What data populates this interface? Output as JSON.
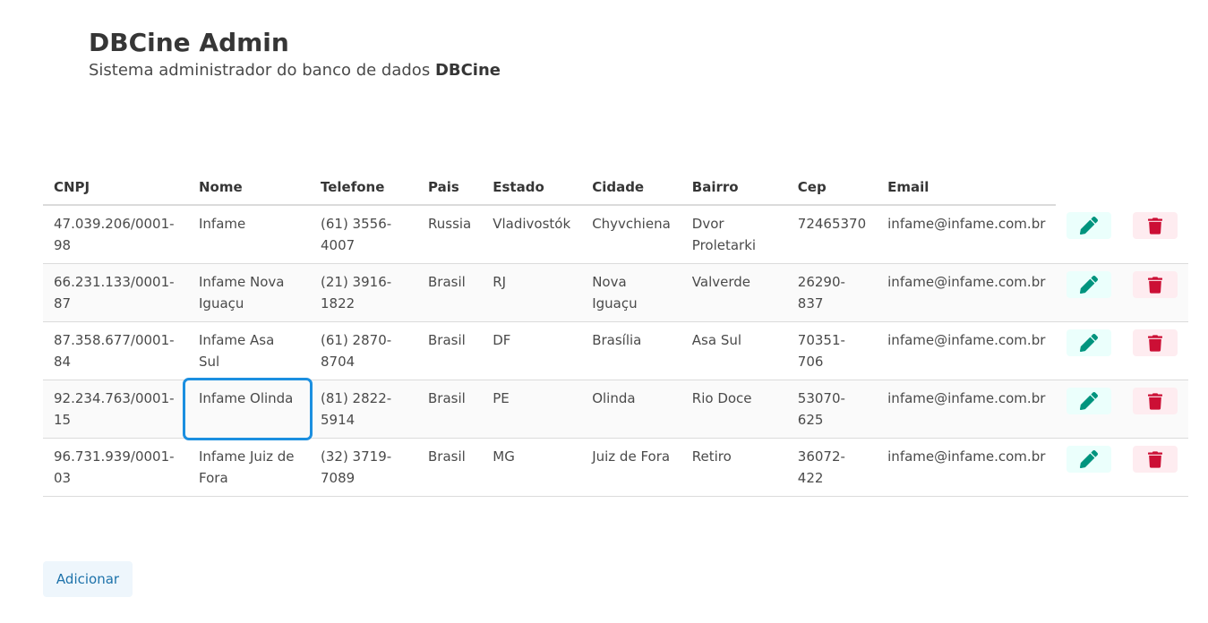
{
  "header": {
    "title": "DBCine Admin",
    "subtitle_prefix": "Sistema administrador do banco de dados",
    "subtitle_strong": "DBCine"
  },
  "table": {
    "columns": [
      "CNPJ",
      "Nome",
      "Telefone",
      "Pais",
      "Estado",
      "Cidade",
      "Bairro",
      "Cep",
      "Email"
    ],
    "rows": [
      {
        "cnpj": "47.039.206/0001-98",
        "nome": "Infame",
        "telefone": "(61) 3556-4007",
        "pais": "Russia",
        "estado": "Vladivostók",
        "cidade": "Chyvchiena",
        "bairro": "Dvor Proletarki",
        "cep": "72465370",
        "email": "infame@infame.com.br"
      },
      {
        "cnpj": "66.231.133/0001-87",
        "nome": "Infame Nova Iguaçu",
        "telefone": "(21) 3916-1822",
        "pais": "Brasil",
        "estado": "RJ",
        "cidade": "Nova Iguaçu",
        "bairro": "Valverde",
        "cep": "26290-837",
        "email": "infame@infame.com.br"
      },
      {
        "cnpj": "87.358.677/0001-84",
        "nome": "Infame Asa Sul",
        "telefone": "(61) 2870-8704",
        "pais": "Brasil",
        "estado": "DF",
        "cidade": "Brasília",
        "bairro": "Asa Sul",
        "cep": "70351-706",
        "email": "infame@infame.com.br"
      },
      {
        "cnpj": "92.234.763/0001-15",
        "nome": "Infame Olinda",
        "telefone": "(81) 2822-5914",
        "pais": "Brasil",
        "estado": "PE",
        "cidade": "Olinda",
        "bairro": "Rio Doce",
        "cep": "53070-625",
        "email": "infame@infame.com.br"
      },
      {
        "cnpj": "96.731.939/0001-03",
        "nome": "Infame Juiz de Fora",
        "telefone": "(32) 3719-7089",
        "pais": "Brasil",
        "estado": "MG",
        "cidade": "Juiz de Fora",
        "bairro": "Retiro",
        "cep": "36072-422",
        "email": "infame@infame.com.br"
      }
    ],
    "focused_cell": "rows.3.nome",
    "actions": {
      "edit_icon": "pencil-icon",
      "delete_icon": "trash-icon"
    }
  },
  "add_button_label": "Adicionar",
  "colors": {
    "edit_icon": "#00947e",
    "edit_bg": "#ebfffc",
    "delete_icon": "#cc0f35",
    "delete_bg": "#feecf0",
    "add_text": "#1d72aa",
    "add_bg": "#eef6fc",
    "focus_ring": "#1b8fe0"
  }
}
